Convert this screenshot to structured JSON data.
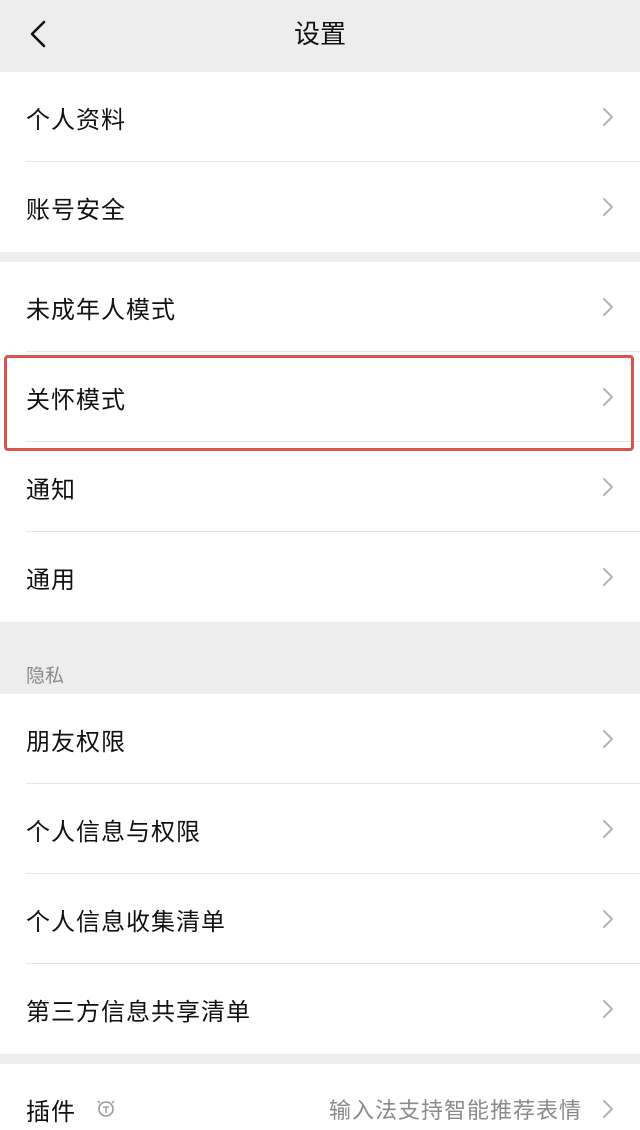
{
  "header": {
    "title": "设置"
  },
  "group1": [
    {
      "label": "个人资料"
    },
    {
      "label": "账号安全"
    }
  ],
  "group2": [
    {
      "label": "未成年人模式"
    },
    {
      "label": "关怀模式"
    },
    {
      "label": "通知"
    },
    {
      "label": "通用"
    }
  ],
  "privacy": {
    "header": "隐私",
    "items": [
      {
        "label": "朋友权限"
      },
      {
        "label": "个人信息与权限"
      },
      {
        "label": "个人信息收集清单"
      },
      {
        "label": "第三方信息共享清单"
      }
    ]
  },
  "plugins": {
    "label": "插件",
    "hint": "输入法支持智能推荐表情",
    "icon": "lightbulb-icon"
  },
  "colors": {
    "background": "#ededed",
    "card": "#ffffff",
    "highlight_border": "#d9534f",
    "secondary_text": "#8a8a8a"
  }
}
